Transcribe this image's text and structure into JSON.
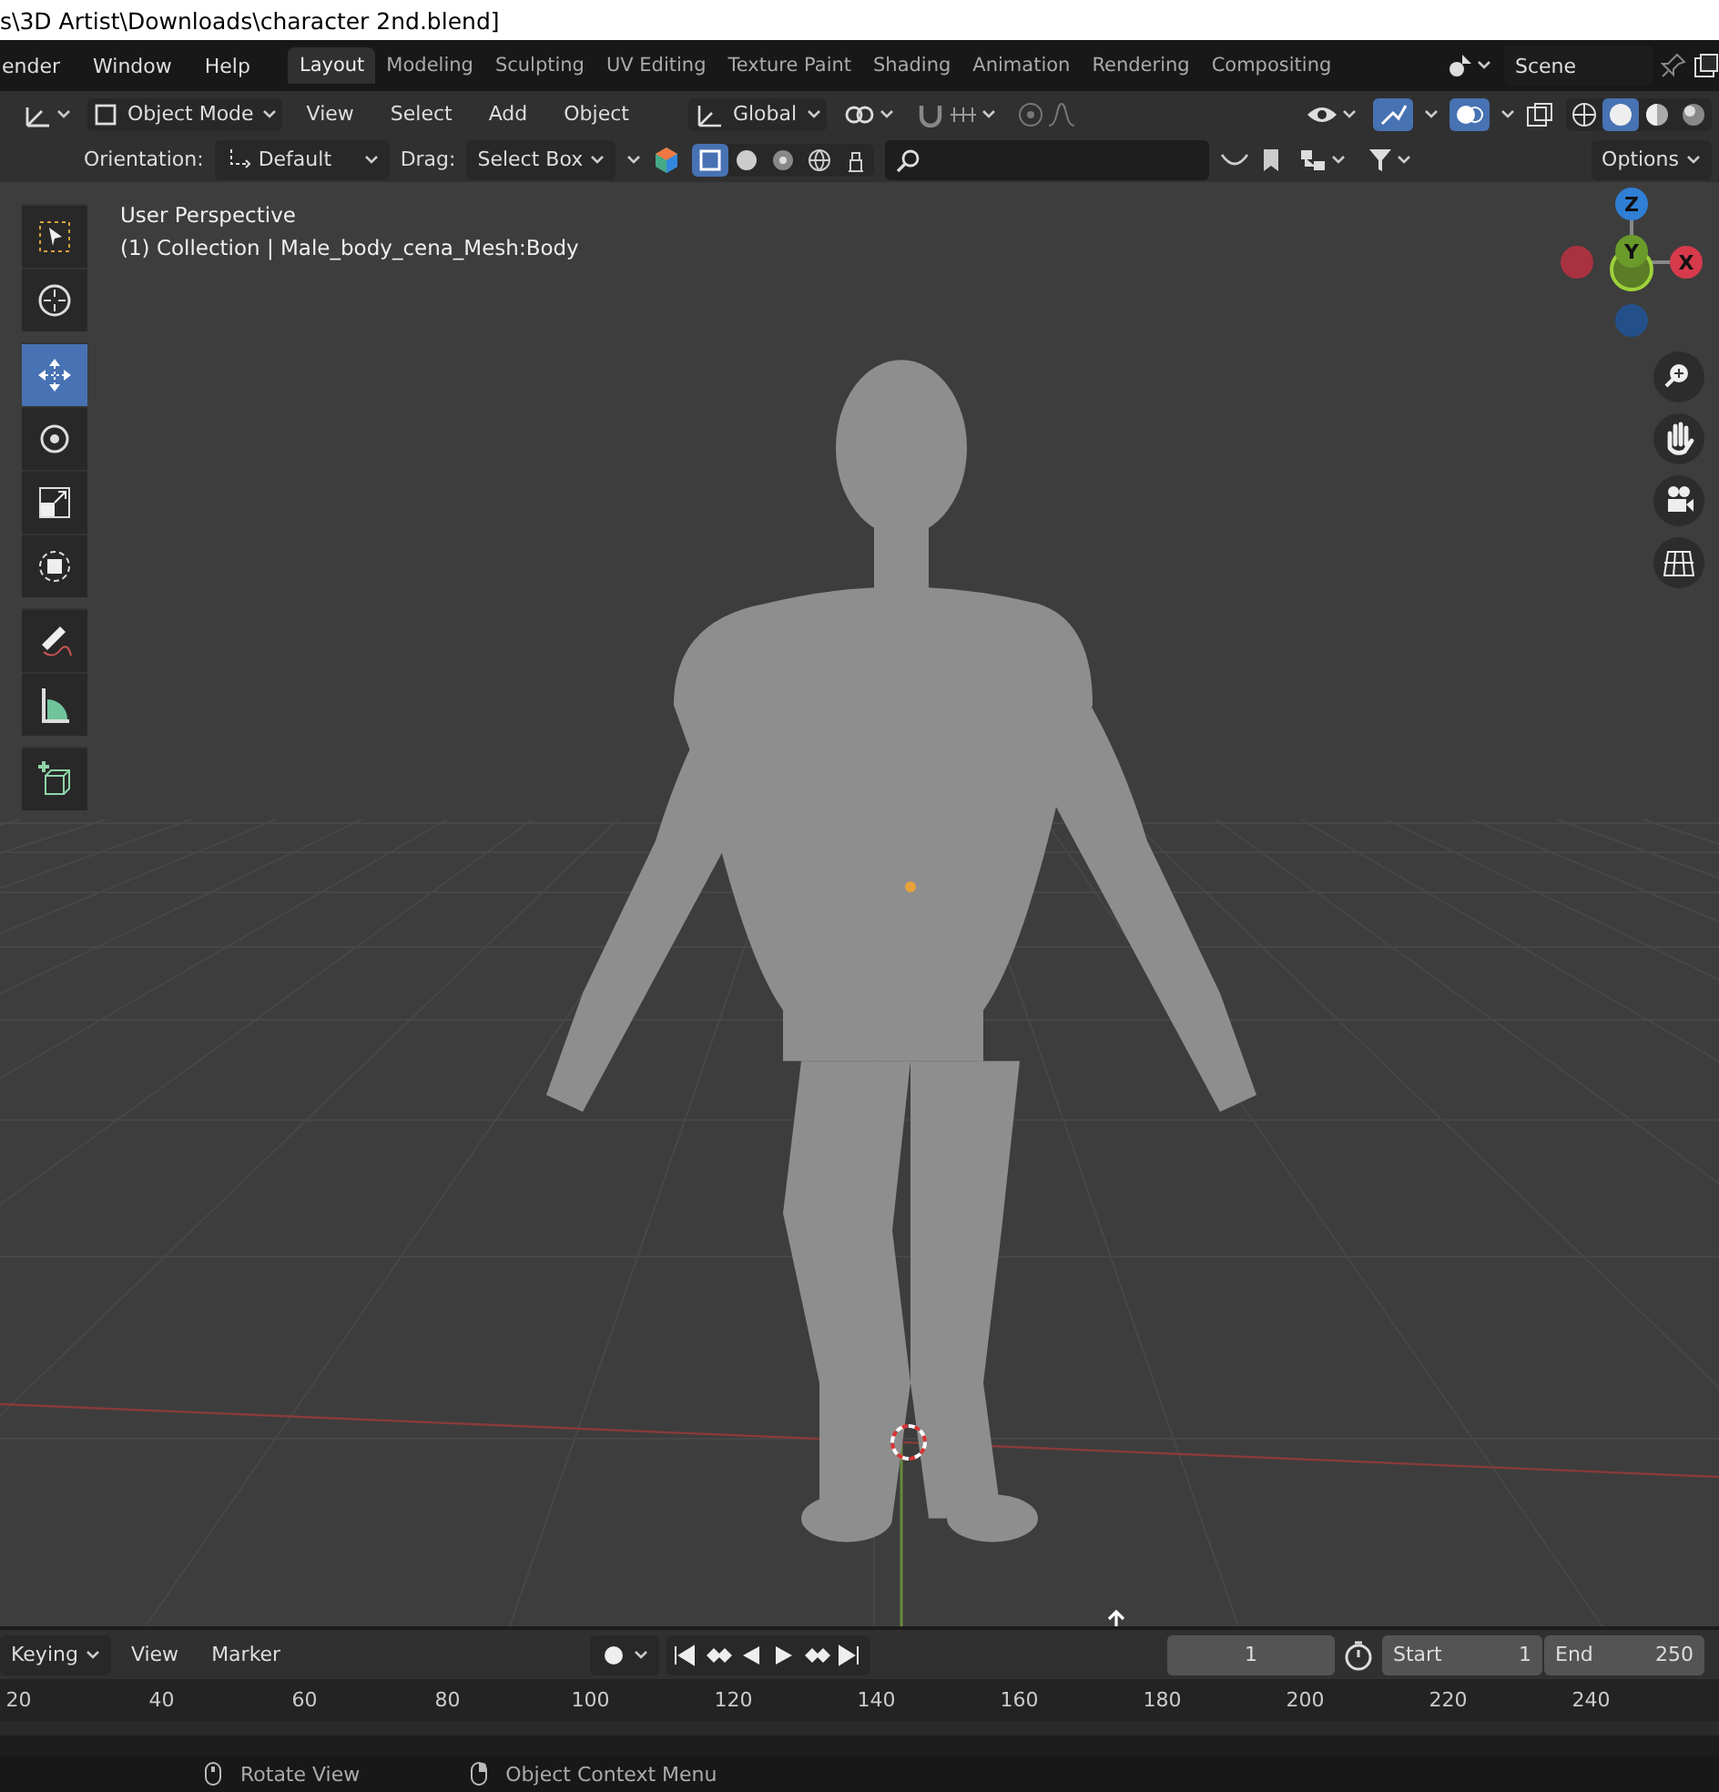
{
  "window": {
    "title": "s\\3D Artist\\Downloads\\character 2nd.blend]"
  },
  "menus": [
    "ender",
    "Window",
    "Help"
  ],
  "workspaces": [
    {
      "label": "Layout",
      "selected": true
    },
    {
      "label": "Modeling",
      "selected": false
    },
    {
      "label": "Sculpting",
      "selected": false
    },
    {
      "label": "UV Editing",
      "selected": false
    },
    {
      "label": "Texture Paint",
      "selected": false
    },
    {
      "label": "Shading",
      "selected": false
    },
    {
      "label": "Animation",
      "selected": false
    },
    {
      "label": "Rendering",
      "selected": false
    },
    {
      "label": "Compositing",
      "selected": false
    }
  ],
  "scene": "Scene",
  "header": {
    "mode": "Object Mode",
    "menus": [
      "View",
      "Select",
      "Add",
      "Object"
    ],
    "transform": "Global",
    "shading": [
      {
        "kind": "wireframe",
        "selected": false
      },
      {
        "kind": "solid",
        "selected": true
      },
      {
        "kind": "material",
        "selected": false
      },
      {
        "kind": "rendered",
        "selected": false
      }
    ]
  },
  "tool_settings": {
    "orientation_label": "Orientation:",
    "orientation": "Default",
    "drag_label": "Drag:",
    "drag": "Select Box",
    "options": "Options"
  },
  "viewport": {
    "overlay": [
      "User Perspective",
      "(1) Collection | Male_body_cena_Mesh:Body"
    ],
    "tools": [
      {
        "kind": "select",
        "selected": false
      },
      {
        "kind": "cursor",
        "selected": false
      },
      {
        "kind": "move",
        "selected": true
      },
      {
        "kind": "rotate",
        "selected": false
      },
      {
        "kind": "scale",
        "selected": false
      },
      {
        "kind": "transform",
        "selected": false
      },
      {
        "kind": "annotate",
        "selected": false
      },
      {
        "kind": "measure",
        "selected": false
      },
      {
        "kind": "add-cube",
        "selected": false
      }
    ],
    "gizmo": [
      "Z",
      "Y",
      "X"
    ]
  },
  "timeline": {
    "keying": "Keying",
    "menus": [
      "View",
      "Marker"
    ],
    "frame": "1",
    "start_label": "Start",
    "start": "1",
    "end_label": "End",
    "end": "250",
    "ticks": [
      "20",
      "40",
      "60",
      "80",
      "100",
      "120",
      "140",
      "160",
      "180",
      "200",
      "220",
      "240"
    ]
  },
  "status_bar": [
    "Rotate View",
    "Object Context Menu"
  ]
}
